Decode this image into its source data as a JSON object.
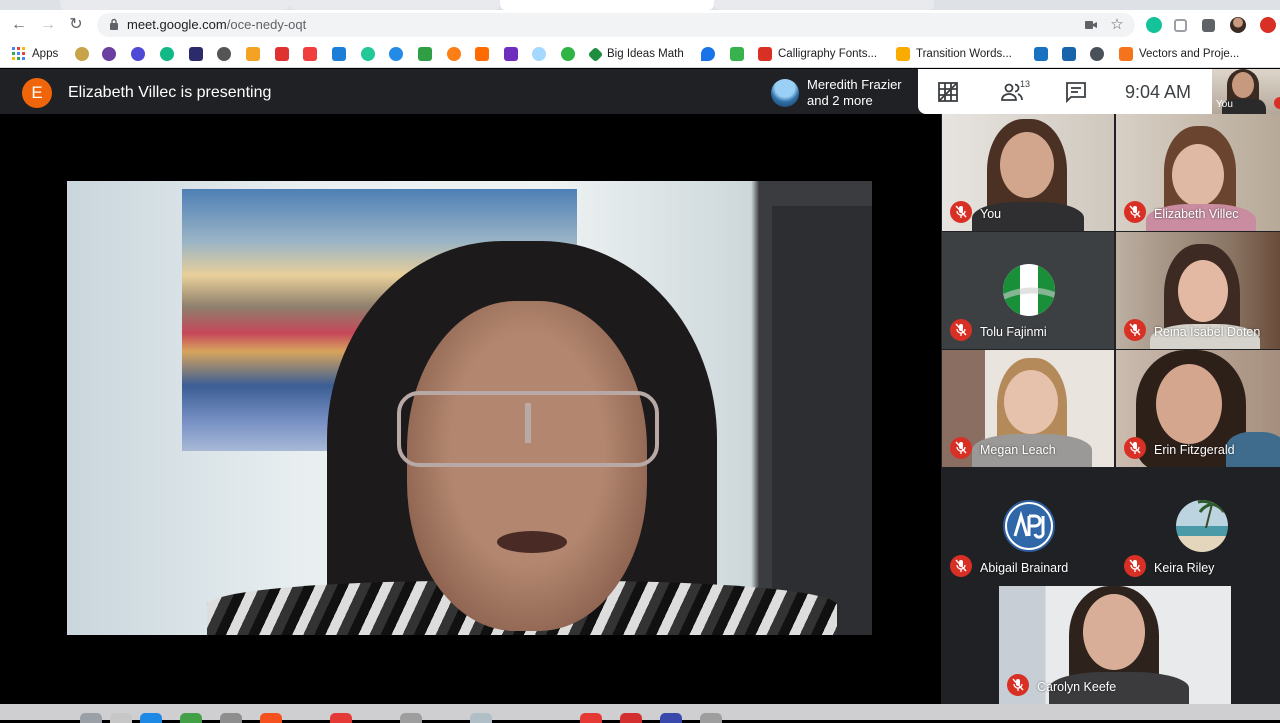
{
  "browser": {
    "url_host": "meet.google.com",
    "url_path": "/oce-nedy-oqt",
    "bookmarks": [
      {
        "label": "Apps",
        "color": "#4285f4"
      },
      {
        "label": "Big Ideas Math",
        "color": "#1e8e3e"
      },
      {
        "label": "Calligraphy Fonts...",
        "color": "#d93025"
      },
      {
        "label": "Transition Words...",
        "color": "#f9ab00"
      },
      {
        "label": "Vectors and Proje...",
        "color": "#f5731d"
      }
    ]
  },
  "meet": {
    "presenter_initial": "E",
    "presenting_text": "Elizabeth Villec is presenting",
    "speaker_line1": "Meredith Frazier",
    "speaker_line2": "and 2 more",
    "participant_count": "13",
    "clock": "9:04 AM",
    "self_label": "You"
  },
  "participants": [
    {
      "name": "You",
      "muted": true
    },
    {
      "name": "Elizabeth Villec",
      "muted": true
    },
    {
      "name": "Tolu Fajinmi",
      "muted": true
    },
    {
      "name": "Reina Isabel Doten",
      "muted": true
    },
    {
      "name": "Megan Leach",
      "muted": true
    },
    {
      "name": "Erin Fitzgerald",
      "muted": true
    },
    {
      "name": "Abigail Brainard",
      "muted": true
    },
    {
      "name": "Keira Riley",
      "muted": true
    },
    {
      "name": "Carolyn Keefe",
      "muted": true
    }
  ],
  "colors": {
    "meet_dark": "#202124",
    "mute_red": "#d93025",
    "presenter_orange": "#f0650a"
  }
}
